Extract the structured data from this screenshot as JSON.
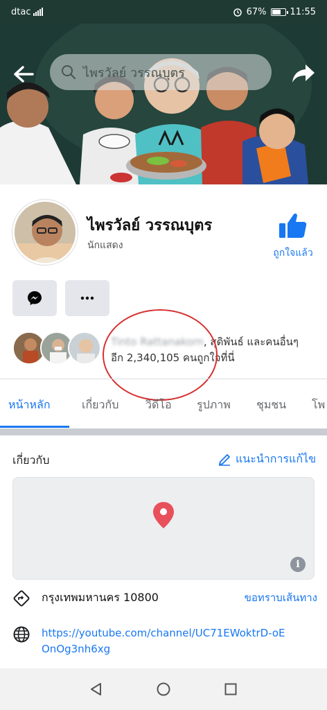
{
  "status_bar": {
    "carrier": "dtac",
    "battery": "67%",
    "time": "11:55"
  },
  "header": {
    "search_text": "ไพรวัลย์ วรรณบุตร"
  },
  "profile": {
    "name": "ไพรวัลย์ วรรณบุตร",
    "category": "นักแสดง",
    "like_label": "ถูกใจแล้ว"
  },
  "likes": {
    "blurred_name": "Tinto Rattanakorn",
    "line1_suffix": ", สุดิพันธ์ และคนอื่นๆ",
    "line2": "อีก 2,340,105 คนถูกใจที่นี่"
  },
  "tabs": [
    {
      "label": "หน้าหลัก"
    },
    {
      "label": "เกี่ยวกับ"
    },
    {
      "label": "วิดีโอ"
    },
    {
      "label": "รูปภาพ"
    },
    {
      "label": "ชุมชน"
    },
    {
      "label": "โพ"
    }
  ],
  "about": {
    "title": "เกี่ยวกับ",
    "suggest_edit": "แนะนำการแก้ไข",
    "address": "กรุงเทพมหานคร 10800",
    "directions": "ขอทราบเส้นทาง",
    "website": "https://youtube.com/channel/UC71EWoktrD-oEOnOg3nh6xg"
  },
  "colors": {
    "accent": "#1877f2",
    "annotation": "#d63030"
  }
}
